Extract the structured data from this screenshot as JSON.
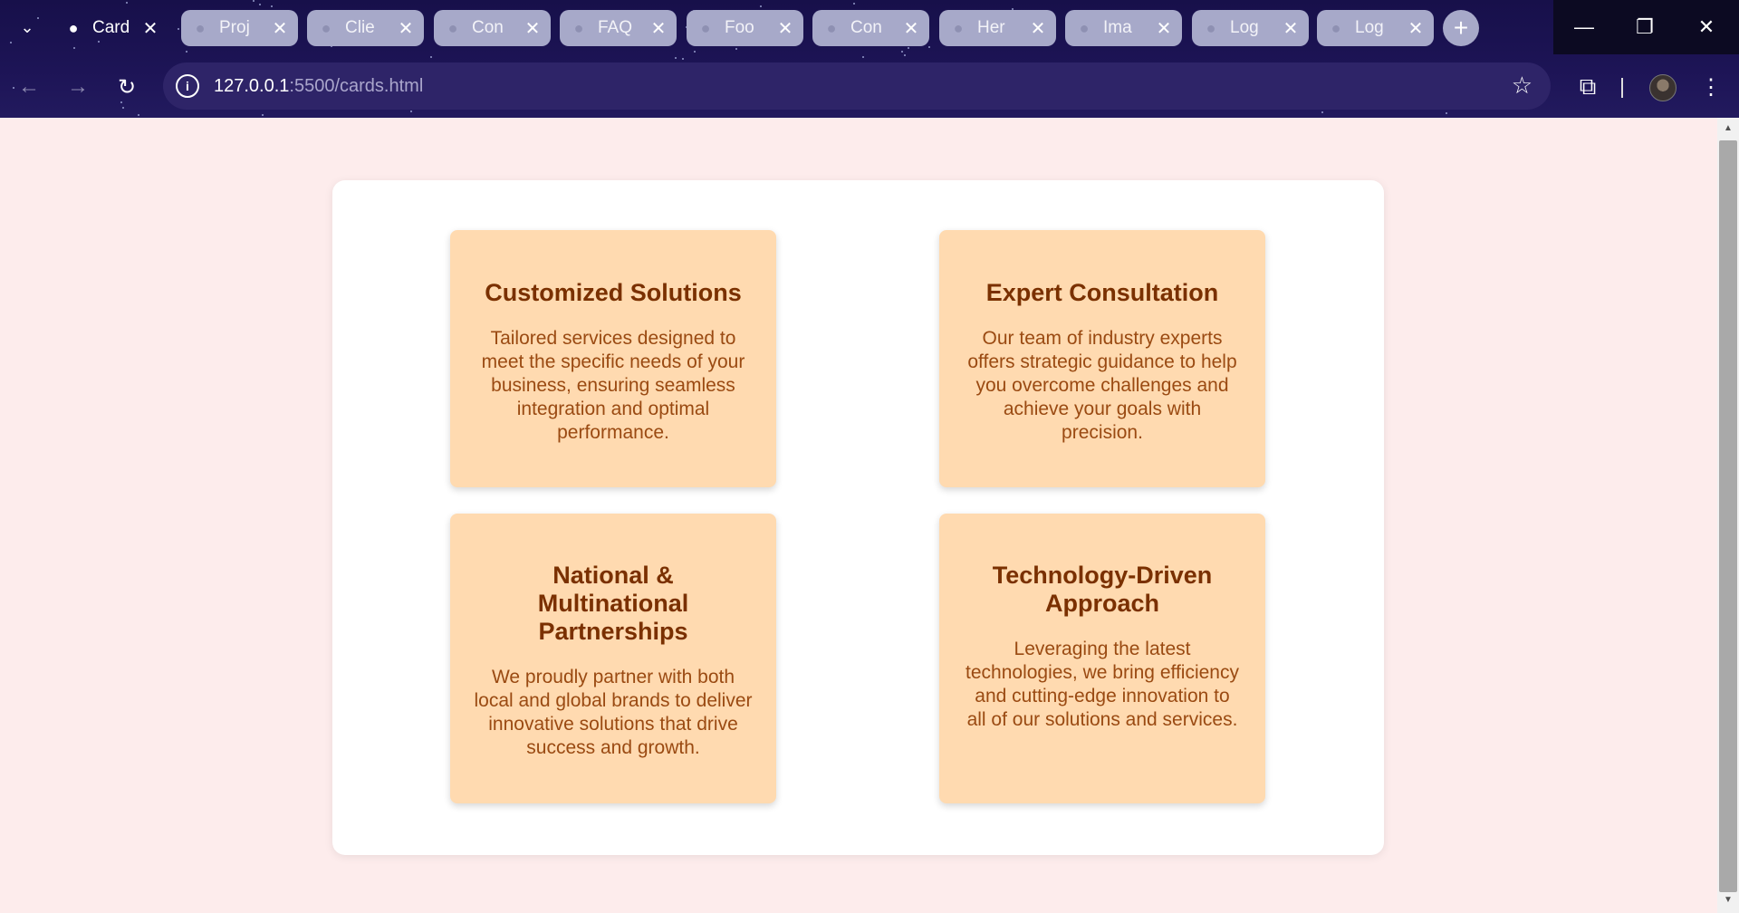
{
  "browser": {
    "tabs": [
      {
        "label": "Card",
        "active": true
      },
      {
        "label": "Proj",
        "active": false
      },
      {
        "label": "Clie",
        "active": false
      },
      {
        "label": "Con",
        "active": false
      },
      {
        "label": "FAQ",
        "active": false
      },
      {
        "label": "Foo",
        "active": false
      },
      {
        "label": "Con",
        "active": false
      },
      {
        "label": "Her",
        "active": false
      },
      {
        "label": "Ima",
        "active": false
      },
      {
        "label": "Log",
        "active": false
      },
      {
        "label": "Log",
        "active": false
      }
    ],
    "url_host": "127.0.0.1",
    "url_path": ":5500/cards.html",
    "icons": {
      "tab_search": "chevron-down-icon",
      "new_tab": "plus-icon",
      "minimize": "minimize-icon",
      "restore": "restore-icon",
      "close": "close-icon",
      "back": "arrow-left-icon",
      "forward": "arrow-right-icon",
      "reload": "reload-icon",
      "site_info": "info-icon",
      "bookmark": "star-icon",
      "extensions": "puzzle-icon",
      "profile": "avatar",
      "menu": "kebab-menu-icon"
    }
  },
  "page": {
    "cards": [
      {
        "title": "Customized Solutions",
        "text": "Tailored services designed to meet the specific needs of your business, ensuring seamless integration and optimal performance."
      },
      {
        "title": "Expert Consultation",
        "text": "Our team of industry experts offers strategic guidance to help you overcome challenges and achieve your goals with precision."
      },
      {
        "title": "National & Multinational Partnerships",
        "text": "We proudly partner with both local and global brands to deliver innovative solutions that drive success and growth."
      },
      {
        "title": "Technology-Driven Approach",
        "text": "Leveraging the latest technologies, we bring efficiency and cutting-edge innovation to all of our solutions and services."
      }
    ],
    "colors": {
      "page_background": "#fdecec",
      "container_background": "#ffffff",
      "card_background": "#ffdab0",
      "card_title": "#7a3000",
      "card_text": "#9a4a12"
    }
  }
}
